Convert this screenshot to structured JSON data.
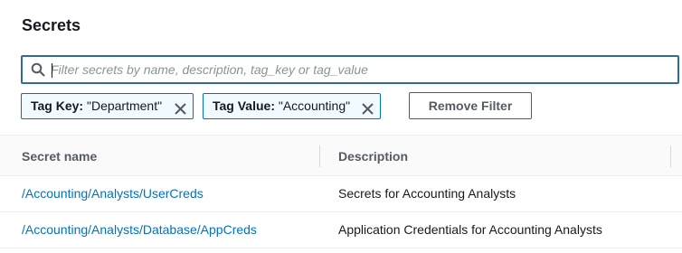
{
  "panel": {
    "title": "Secrets"
  },
  "search": {
    "placeholder": "Filter secrets by name, description, tag_key or tag_value",
    "value": ""
  },
  "filters": [
    {
      "key_label": "Tag Key:",
      "value_text": "\"Department\""
    },
    {
      "key_label": "Tag Value:",
      "value_text": "\"Accounting\""
    }
  ],
  "remove_filter_label": "Remove Filter",
  "table": {
    "columns": [
      "Secret name",
      "Description"
    ],
    "rows": [
      {
        "name": "/Accounting/Analysts/UserCreds",
        "description": "Secrets for Accounting Analysts"
      },
      {
        "name": "/Accounting/Analysts/Database/AppCreds",
        "description": "Application Credentials for Accounting Analysts"
      }
    ]
  },
  "colors": {
    "link": "#0073bb",
    "token_border": "#0073bb",
    "token_bg": "#f1faff"
  }
}
